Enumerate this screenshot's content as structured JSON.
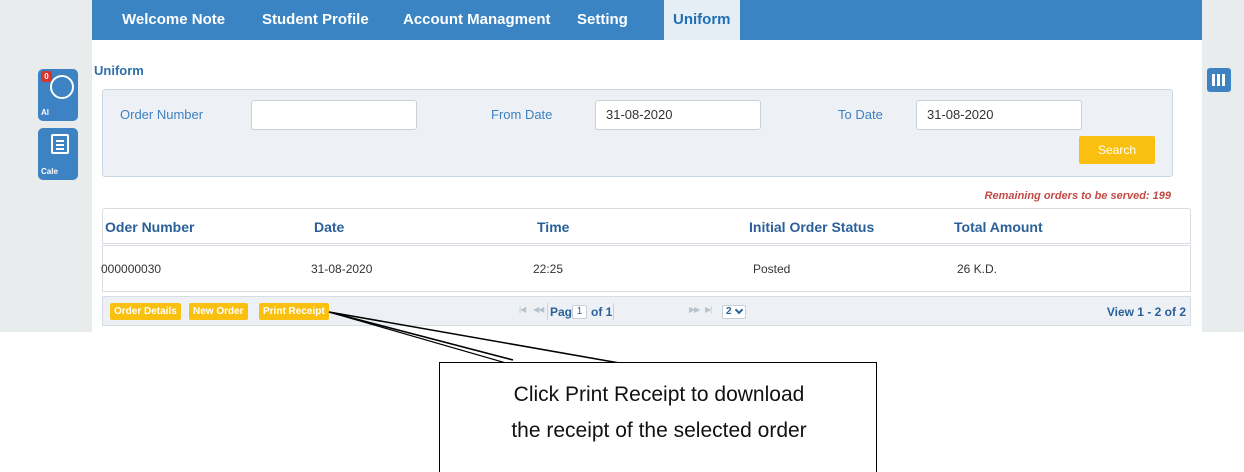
{
  "side_panel": {
    "alerts_badge": "0",
    "alerts_label": "Al",
    "calendar_label": "Cale"
  },
  "nav": {
    "tabs": [
      "Welcome Note",
      "Student Profile",
      "Account Managment",
      "Setting",
      "Uniform"
    ],
    "active": "Uniform"
  },
  "page": {
    "title": "Uniform"
  },
  "filters": {
    "order_number_label": "Order Number",
    "order_number_value": "",
    "from_date_label": "From Date",
    "from_date_value": "31-08-2020",
    "to_date_label": "To Date",
    "to_date_value": "31-08-2020",
    "search_label": "Search"
  },
  "remaining_note": "Remaining orders to be served: 199",
  "grid": {
    "columns": [
      "Oder Number",
      "Date",
      "Time",
      "Initial Order Status",
      "Total Amount"
    ],
    "rows": [
      [
        "000000030",
        "31-08-2020",
        "22:25",
        "Posted",
        "26 K.D."
      ]
    ]
  },
  "footer": {
    "buttons": [
      "Order Details",
      "New Order",
      "Print Receipt"
    ],
    "page_label": "Page",
    "page_value": "1",
    "of_label": "of 1",
    "rows_per_page": "2",
    "view_range": "View 1 - 2 of 2"
  },
  "annotation": {
    "line1": "Click Print Receipt to download",
    "line2": "the receipt of the selected order"
  },
  "colors": {
    "nav_blue": "#3a84c4",
    "accent_yellow": "#f9c010",
    "note_red": "#c44a45"
  }
}
